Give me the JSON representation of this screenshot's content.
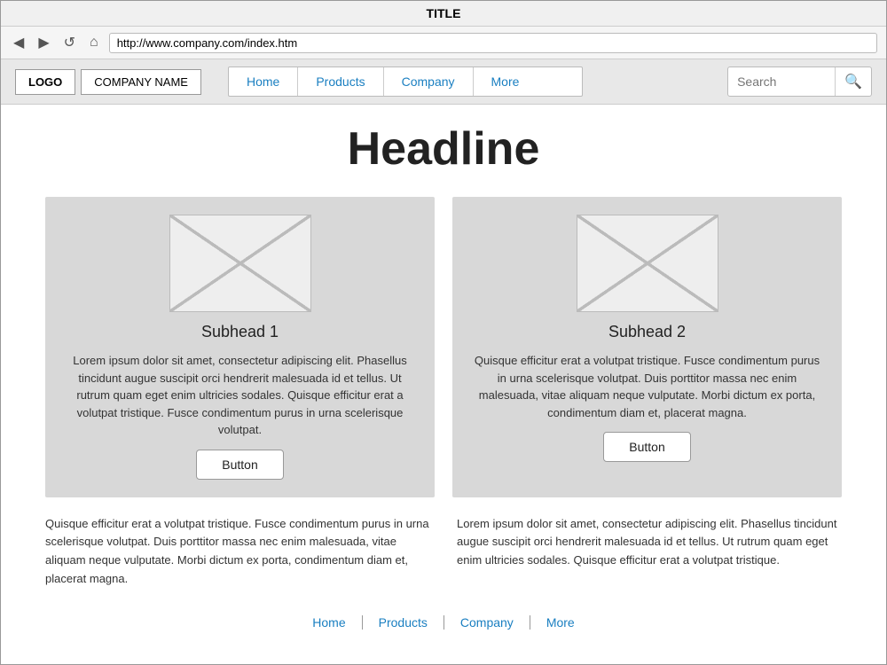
{
  "browser": {
    "title": "TITLE",
    "url": "http://www.company.com/index.htm",
    "back_icon": "◀",
    "forward_icon": "▶",
    "refresh_icon": "↺",
    "home_icon": "⌂"
  },
  "header": {
    "logo_label": "LOGO",
    "company_name": "COMPANY NAME",
    "nav": [
      {
        "label": "Home",
        "href": "#"
      },
      {
        "label": "Products",
        "href": "#"
      },
      {
        "label": "Company",
        "href": "#"
      },
      {
        "label": "More",
        "href": "#"
      }
    ],
    "search_placeholder": "Search",
    "search_icon": "🔍"
  },
  "main": {
    "headline": "Headline",
    "cards": [
      {
        "subhead": "Subhead 1",
        "text": "Lorem ipsum dolor sit amet, consectetur adipiscing elit. Phasellus tincidunt augue suscipit orci hendrerit malesuada id et tellus. Ut rutrum quam eget enim ultricies sodales. Quisque efficitur erat a volutpat tristique. Fusce condimentum purus in urna scelerisque volutpat.",
        "button": "Button"
      },
      {
        "subhead": "Subhead 2",
        "text": "Quisque efficitur erat a volutpat tristique. Fusce condimentum purus in urna scelerisque volutpat. Duis porttitor massa nec enim malesuada, vitae aliquam neque vulputate. Morbi dictum ex porta, condimentum diam et, placerat magna.",
        "button": "Button"
      }
    ],
    "bottom_texts": [
      "Quisque efficitur erat a volutpat tristique. Fusce condimentum purus in urna scelerisque volutpat. Duis porttitor massa nec enim malesuada, vitae aliquam neque vulputate. Morbi dictum ex porta, condimentum diam et, placerat magna.",
      "Lorem ipsum dolor sit amet, consectetur adipiscing elit. Phasellus tincidunt augue suscipit orci hendrerit malesuada id et tellus. Ut rutrum quam eget enim ultricies sodales. Quisque efficitur erat a volutpat tristique."
    ]
  },
  "footer": {
    "nav": [
      {
        "label": "Home",
        "href": "#"
      },
      {
        "label": "Products",
        "href": "#"
      },
      {
        "label": "Company",
        "href": "#"
      },
      {
        "label": "More",
        "href": "#"
      }
    ]
  }
}
